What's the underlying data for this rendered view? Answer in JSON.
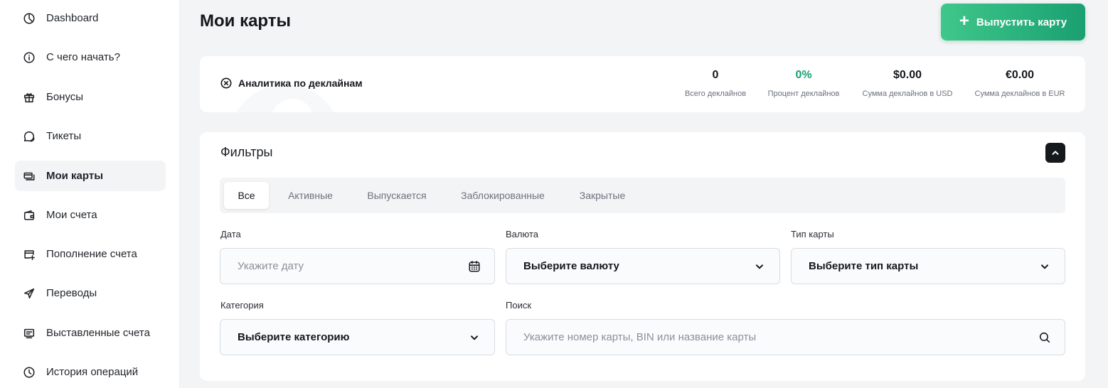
{
  "sidebar": {
    "items": [
      {
        "label": "Dashboard",
        "icon": "pie-chart-icon"
      },
      {
        "label": "С чего начать?",
        "icon": "info-icon"
      },
      {
        "label": "Бонусы",
        "icon": "gift-icon"
      },
      {
        "label": "Тикеты",
        "icon": "chat-icon"
      },
      {
        "label": "Мои карты",
        "icon": "cards-icon",
        "active": true
      },
      {
        "label": "Мои счета",
        "icon": "wallet-icon"
      },
      {
        "label": "Пополнение счета",
        "icon": "card-add-icon"
      },
      {
        "label": "Переводы",
        "icon": "send-icon"
      },
      {
        "label": "Выставленные счета",
        "icon": "invoice-icon"
      },
      {
        "label": "История операций",
        "icon": "clock-icon"
      }
    ]
  },
  "header": {
    "title": "Мои карты",
    "issue_button": {
      "icon": "plus-icon",
      "label": "Выпустить карту"
    }
  },
  "analytics": {
    "title": "Аналитика по деклайнам",
    "icon": "close-circle-icon",
    "stats": [
      {
        "value": "0",
        "label": "Всего деклайнов"
      },
      {
        "value": "0%",
        "label": "Процент деклайнов"
      },
      {
        "value": "$0.00",
        "label": "Сумма деклайнов в USD"
      },
      {
        "value": "€0.00",
        "label": "Сумма деклайнов в EUR"
      }
    ]
  },
  "filters": {
    "title": "Фильтры",
    "collapse_icon": "chevron-up-icon",
    "tabs": [
      "Все",
      "Активные",
      "Выпускается",
      "Заблокированные",
      "Закрытые"
    ],
    "active_tab": "Все",
    "date": {
      "label": "Дата",
      "placeholder": "Укажите дату",
      "icon": "calendar-icon"
    },
    "currency": {
      "label": "Валюта",
      "value": "Выберите валюту"
    },
    "card_type": {
      "label": "Тип карты",
      "value": "Выберите тип карты"
    },
    "category": {
      "label": "Категория",
      "value": "Выберите категорию"
    },
    "search": {
      "label": "Поиск",
      "placeholder": "Укажите номер карты, BIN или название карты",
      "icon": "search-icon"
    }
  },
  "colors": {
    "accent": "#1aa071",
    "accent_light": "#40c78b",
    "dark": "#15181d"
  }
}
